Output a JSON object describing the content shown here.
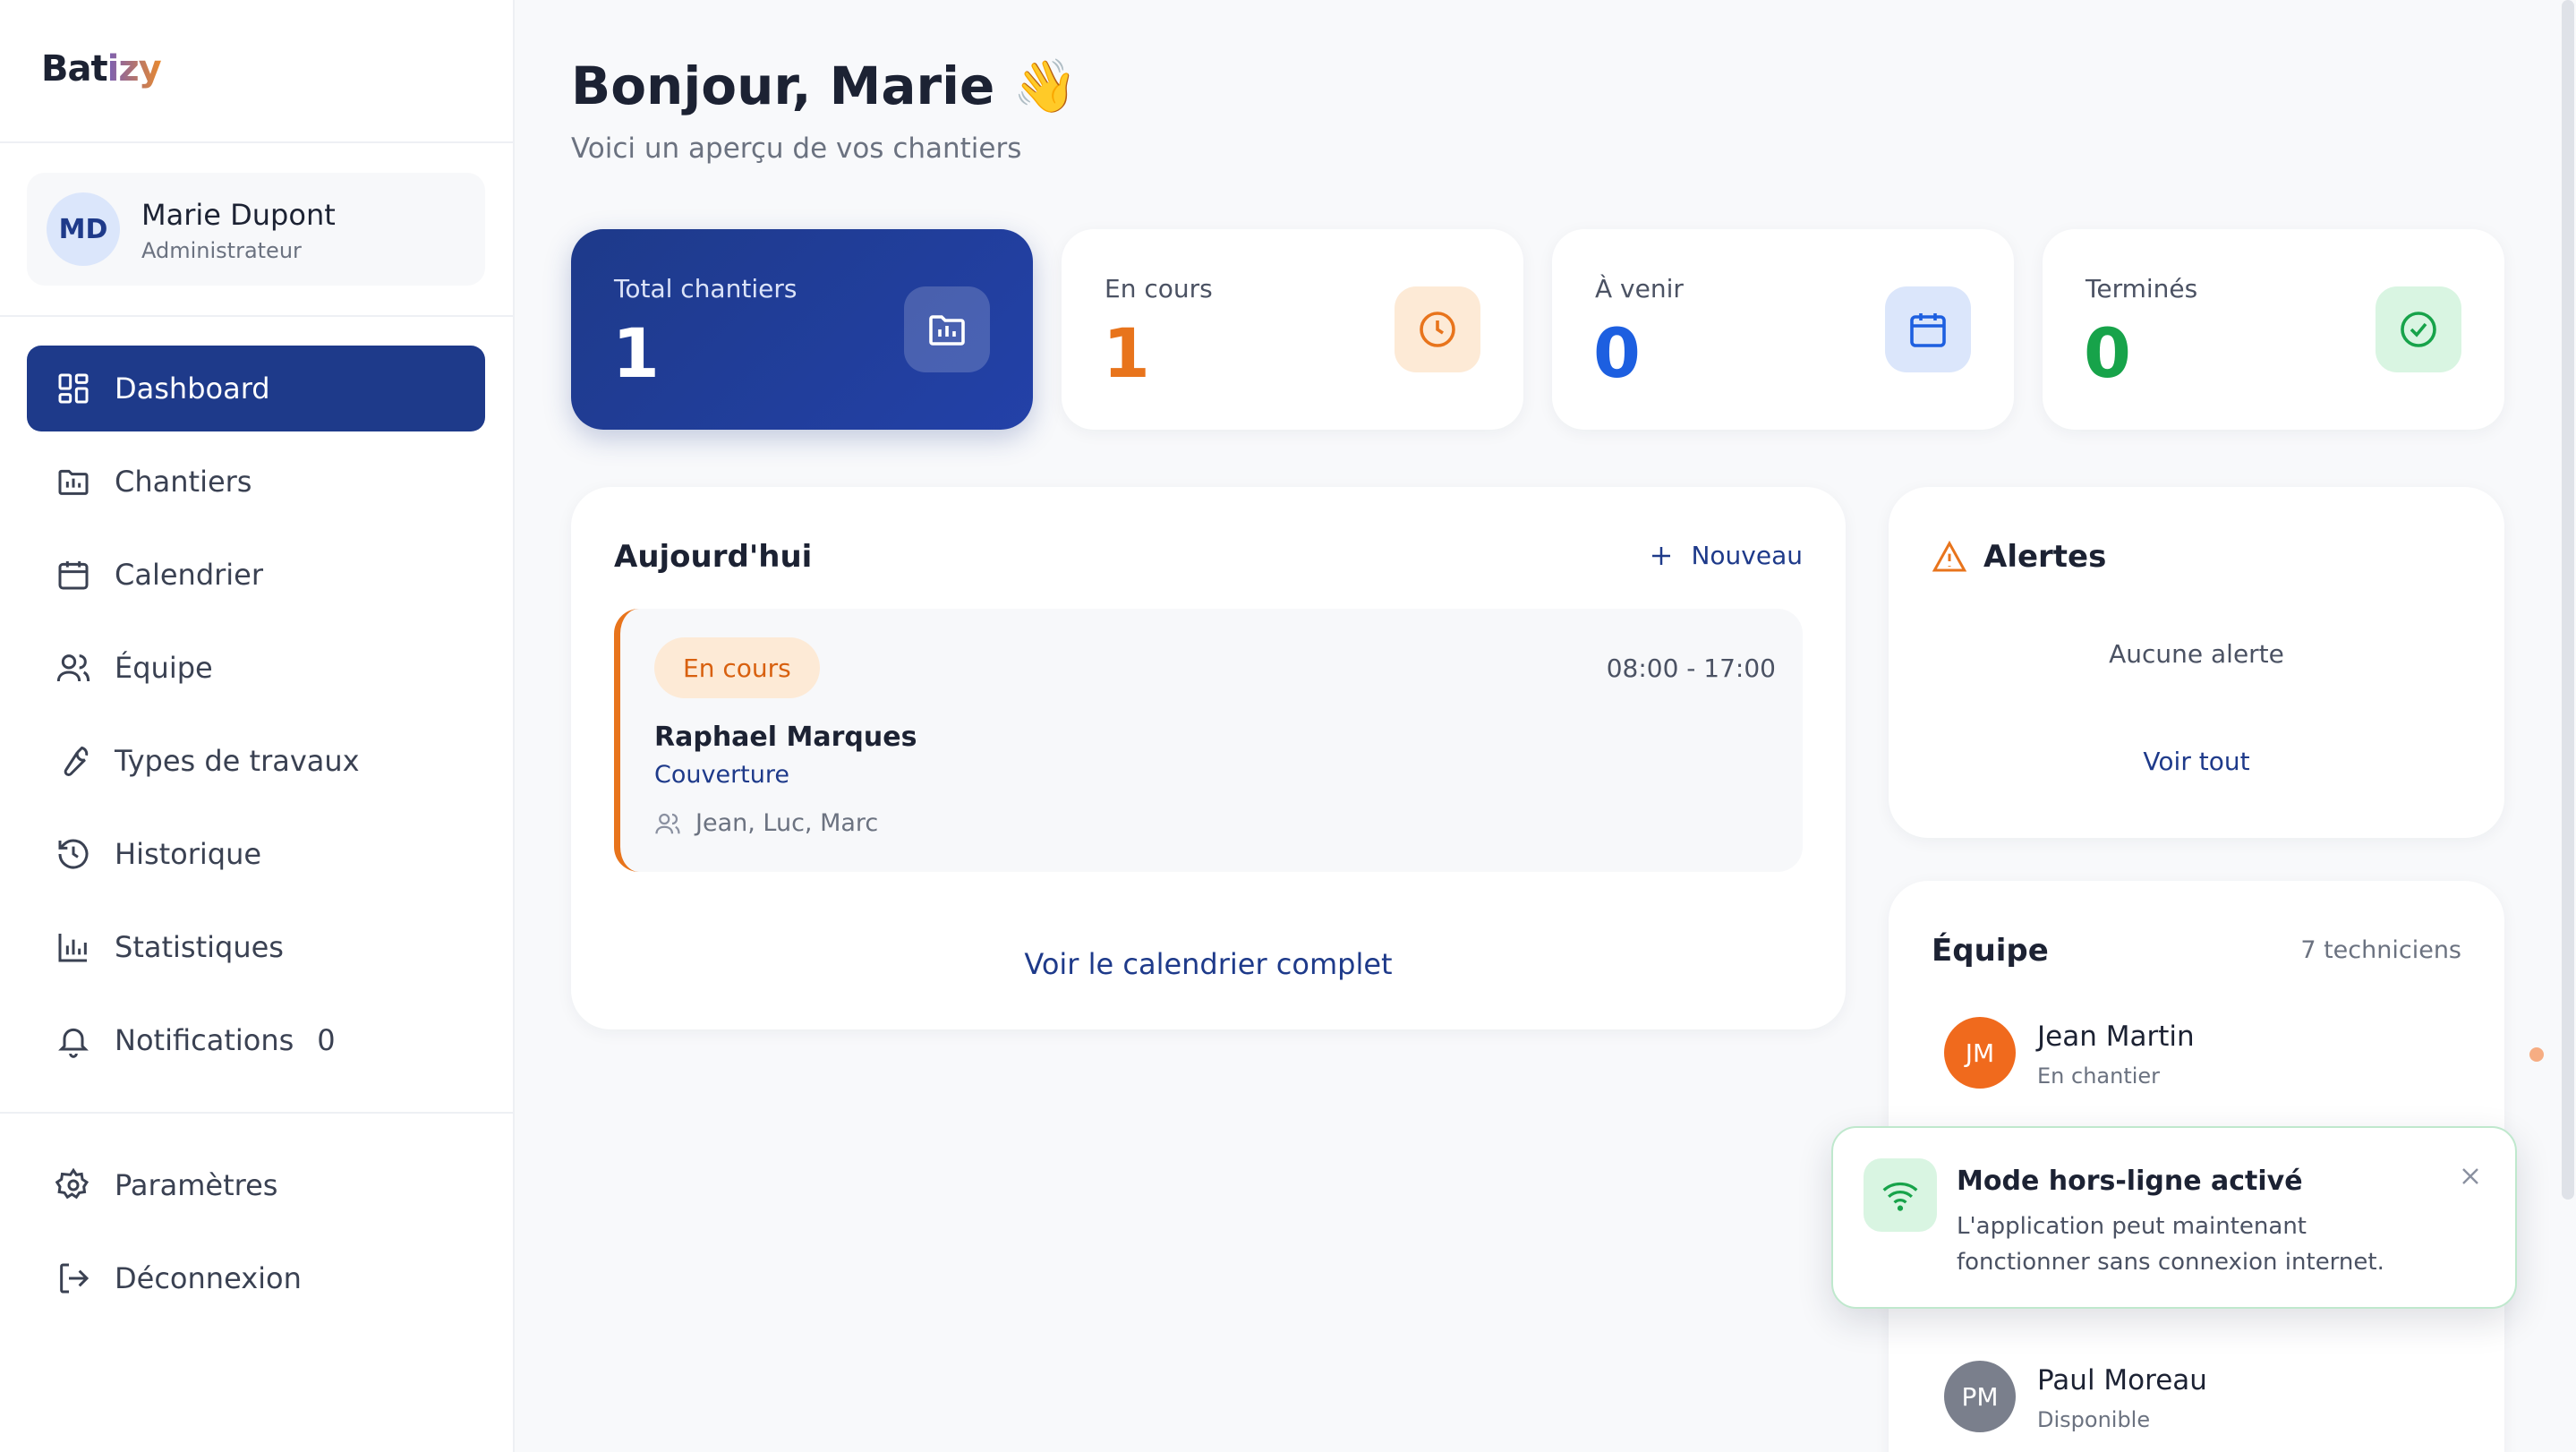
{
  "app": {
    "logo_prefix": "Bat",
    "logo_accent": "izy"
  },
  "user": {
    "initials": "MD",
    "name": "Marie Dupont",
    "role": "Administrateur"
  },
  "nav": {
    "items": [
      {
        "label": "Dashboard",
        "icon": "grid-icon",
        "active": true
      },
      {
        "label": "Chantiers",
        "icon": "folder-icon"
      },
      {
        "label": "Calendrier",
        "icon": "calendar-icon"
      },
      {
        "label": "Équipe",
        "icon": "users-icon"
      },
      {
        "label": "Types de travaux",
        "icon": "wrench-icon"
      },
      {
        "label": "Historique",
        "icon": "history-icon"
      },
      {
        "label": "Statistiques",
        "icon": "bar-chart-icon"
      },
      {
        "label": "Notifications",
        "icon": "bell-icon",
        "count": "0"
      }
    ],
    "footer": [
      {
        "label": "Paramètres",
        "icon": "gear-icon"
      },
      {
        "label": "Déconnexion",
        "icon": "logout-icon"
      }
    ]
  },
  "header": {
    "greeting": "Bonjour, Marie 👋",
    "subtitle": "Voici un aperçu de vos chantiers"
  },
  "stats": [
    {
      "label": "Total chantiers",
      "value": "1",
      "icon": "folder-icon",
      "color": "#ffffff"
    },
    {
      "label": "En cours",
      "value": "1",
      "icon": "clock-icon",
      "color": "#e8741c"
    },
    {
      "label": "À venir",
      "value": "0",
      "icon": "calendar-icon",
      "color": "#1d5fe0"
    },
    {
      "label": "Terminés",
      "value": "0",
      "icon": "check-circle-icon",
      "color": "#17a34a"
    }
  ],
  "today": {
    "title": "Aujourd'hui",
    "new_label": "Nouveau",
    "event": {
      "status": "En cours",
      "time": "08:00 - 17:00",
      "client": "Raphael Marques",
      "type": "Couverture",
      "team": "Jean, Luc, Marc"
    },
    "calendar_link": "Voir le calendrier complet"
  },
  "alerts": {
    "title": "Alertes",
    "empty": "Aucune alerte",
    "link": "Voir tout"
  },
  "team": {
    "title": "Équipe",
    "count": "7 techniciens",
    "members": [
      {
        "initials": "JM",
        "name": "Jean Martin",
        "status": "En chantier",
        "color": "#f06a1d"
      },
      {
        "initials": "PM",
        "name": "Paul Moreau",
        "status": "Disponible",
        "color": "#7a7f8c"
      }
    ]
  },
  "toast": {
    "title": "Mode hors-ligne activé",
    "message": "L'application peut maintenant fonctionner sans connexion internet."
  },
  "colors": {
    "primary": "#1e3a8a",
    "orange": "#e8741c",
    "blue": "#1d5fe0",
    "green": "#17a34a"
  }
}
